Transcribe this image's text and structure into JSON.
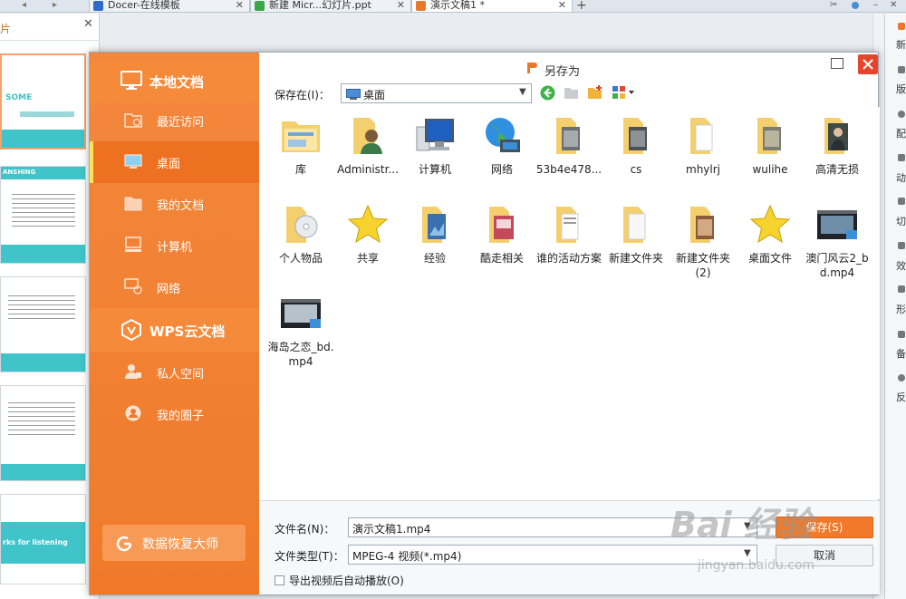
{
  "tabs": [
    {
      "label": "Docer-在线模板",
      "color": "#2f6cc8"
    },
    {
      "label": "新建 Micr...幻灯片.ppt",
      "color": "#3aa84a"
    },
    {
      "label": "演示文稿1 *",
      "color": "#e9772c"
    }
  ],
  "left_pane": {
    "title": "片",
    "slides": [
      {
        "caption": "SOME"
      },
      {
        "caption": "ANSHING"
      },
      {
        "caption": ""
      },
      {
        "caption": ""
      },
      {
        "caption": "rks for listening"
      }
    ]
  },
  "right_bar": {
    "items": [
      "新",
      "版",
      "配",
      "动",
      "切",
      "效",
      "形",
      "备",
      "反"
    ]
  },
  "dialog": {
    "title": "另存为",
    "sidebar": {
      "local_title": "本地文档",
      "local_items": [
        "最近访问",
        "桌面",
        "我的文档",
        "计算机",
        "网络"
      ],
      "cloud_title": "WPS云文档",
      "cloud_items": [
        "私人空间",
        "我的圈子"
      ],
      "recover_label": "数据恢复大师"
    },
    "toolbar": {
      "save_in_label": "保存在(I)：",
      "location": "桌面"
    },
    "files": [
      {
        "name": "库",
        "icon": "library-folder-icon"
      },
      {
        "name": "Administr...",
        "icon": "user-folder-icon"
      },
      {
        "name": "计算机",
        "icon": "computer-icon"
      },
      {
        "name": "网络",
        "icon": "network-globe-icon"
      },
      {
        "name": "53b4e478...",
        "icon": "photo-folder-icon"
      },
      {
        "name": "cs",
        "icon": "photo-folder-icon"
      },
      {
        "name": "mhylrj",
        "icon": "document-folder-icon"
      },
      {
        "name": "wulihe",
        "icon": "photo-folder-icon"
      },
      {
        "name": "高清无损",
        "icon": "person-folder-icon"
      },
      {
        "name": "个人物品",
        "icon": "disc-folder-icon"
      },
      {
        "name": "共享",
        "icon": "star-icon"
      },
      {
        "name": "经验",
        "icon": "blue-folder-icon"
      },
      {
        "name": "酷走相关",
        "icon": "photo-folder-icon"
      },
      {
        "name": "谁的活动方案",
        "icon": "document-folder-icon"
      },
      {
        "name": "新建文件夹",
        "icon": "document-folder-icon"
      },
      {
        "name": "新建文件夹 (2)",
        "icon": "photo-folder-icon"
      },
      {
        "name": "桌面文件",
        "icon": "star-icon"
      },
      {
        "name": "澳门风云2_bd.mp4",
        "icon": "video-file-icon"
      },
      {
        "name": "海岛之恋_bd.mp4",
        "icon": "video-file-icon"
      }
    ],
    "filename_label": "文件名(N)：",
    "filename_value": "演示文稿1.mp4",
    "filetype_label": "文件类型(T)：",
    "filetype_value": "MPEG-4 视频(*.mp4)",
    "save_button": "保存(S)",
    "cancel_button": "取消",
    "checkbox_label": "导出视频后自动播放(O)"
  },
  "watermark": {
    "main": "Bai 经验",
    "sub": "jingyan.baidu.com"
  },
  "colors": {
    "accent": "#f07a2a",
    "close": "#e5452c",
    "teal": "#3fc4c9"
  }
}
